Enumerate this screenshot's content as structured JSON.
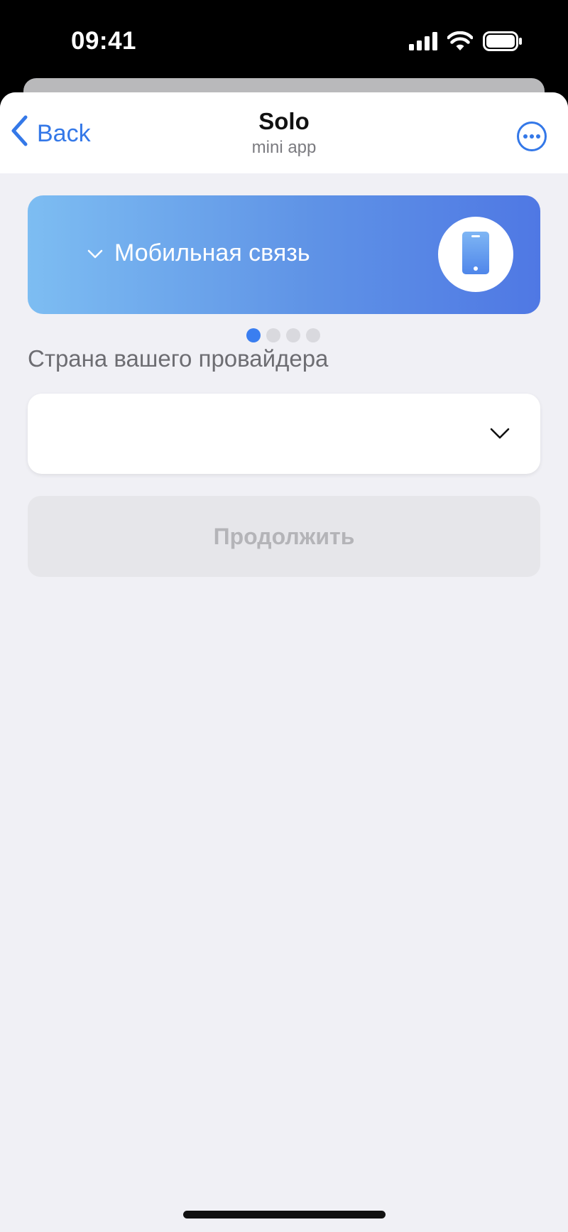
{
  "status_bar": {
    "time": "09:41",
    "icons": [
      "cellular-signal-icon",
      "wifi-icon",
      "battery-icon"
    ]
  },
  "nav": {
    "back_label": "Back",
    "title": "Solo",
    "subtitle": "mini app",
    "more_icon": "more-icon"
  },
  "banner": {
    "label": "Мобильная связь",
    "icon": "smartphone-icon",
    "chevron_icon": "chevron-down-icon"
  },
  "pagination": {
    "count": 4,
    "active_index": 0
  },
  "form": {
    "country_label": "Страна вашего провайдера",
    "country_value": "",
    "continue_label": "Продолжить"
  },
  "colors": {
    "accent": "#3478e8",
    "background": "#f0f0f5",
    "banner_start": "#7dbdf2",
    "banner_end": "#4f78e4",
    "disabled_button": "#e6e6ea",
    "disabled_text": "#b4b4b8"
  }
}
